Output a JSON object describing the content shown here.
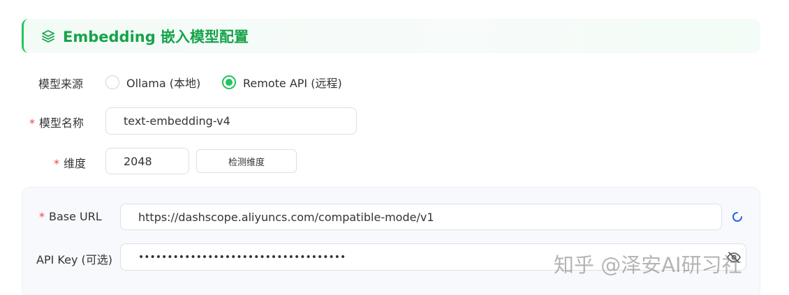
{
  "header": {
    "title": "Embedding 嵌入模型配置",
    "icon": "layers-icon"
  },
  "source": {
    "label": "模型来源",
    "options": [
      {
        "label": "Ollama (本地)",
        "checked": false
      },
      {
        "label": "Remote API (远程)",
        "checked": true
      }
    ]
  },
  "model_name": {
    "required_mark": "*",
    "label": "模型名称",
    "value": "text-embedding-v4"
  },
  "dimension": {
    "required_mark": "*",
    "label": "维度",
    "value": "2048",
    "detect_button": "检测维度"
  },
  "base_url": {
    "required_mark": "*",
    "label": "Base URL",
    "value": "https://dashscope.aliyuncs.com/compatible-mode/v1",
    "refresh_icon": "refresh-icon"
  },
  "api_key": {
    "label": "API Key (可选)",
    "value": "••••••••••••••••••••••••••••••••••••",
    "eye_icon": "eye-hidden-icon"
  },
  "watermark": "知乎 @泽安AI研习社",
  "colors": {
    "accent": "#22c55e",
    "accent_text": "#16a34a",
    "required": "#ef4444",
    "panel_bg": "#f7f9fc"
  }
}
